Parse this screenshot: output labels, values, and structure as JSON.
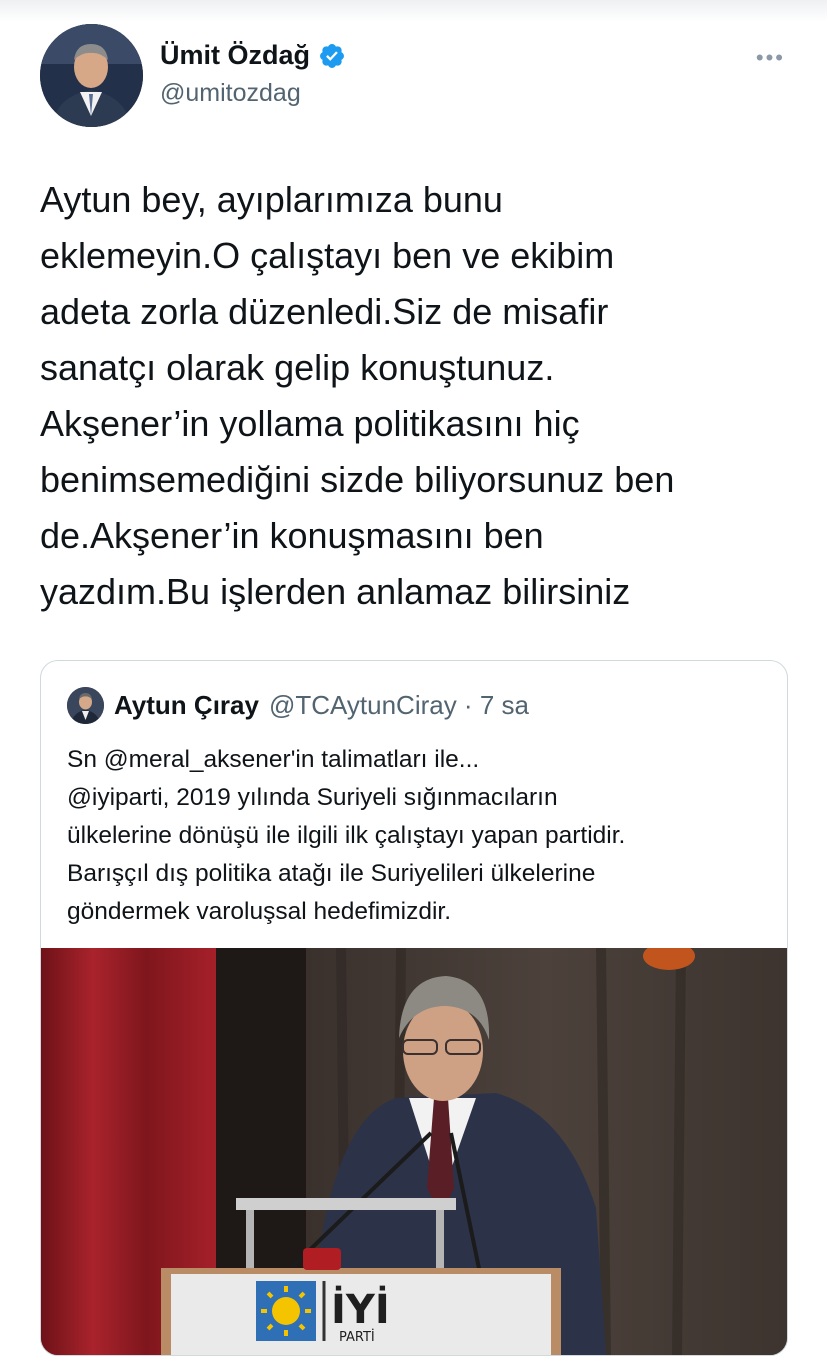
{
  "tweet": {
    "author_name": "Ümit Özdağ",
    "author_handle": "@umitozdag",
    "lines": [
      "Aytun bey, ayıplarımıza bunu",
      "eklemeyin.O çalıştayı ben ve ekibim",
      "adeta zorla düzenledi.Siz de misafir",
      "sanatçı olarak gelip konuştunuz.",
      "Akşener’in yollama politikasını hiç",
      "benimsemediğini sizde biliyorsunuz ben",
      "de.Akşener’in konuşmasını ben",
      "yazdım.Bu işlerden anlamaz bilirsiniz"
    ],
    "more_label": "•••"
  },
  "quote": {
    "author_name": "Aytun Çıray",
    "author_handle": "@TCAytunCiray · 7 sa",
    "lines": [
      "Sn @meral_aksener'in talimatları ile...",
      "@iyiparti, 2019 yılında Suriyeli sığınmacıların",
      "ülkelerine dönüşü ile ilgili ilk çalıştayı yapan partidir.",
      "Barışçıl dış politika atağı ile Suriyelileri ülkelerine",
      "göndermek varoluşsal hedefimizdir."
    ],
    "media": {
      "podium_logo_main": "İYİ",
      "podium_logo_sub": "PARTİ"
    }
  },
  "colors": {
    "verified": "#1d9bf0",
    "text": "#0f1419",
    "secondary": "#536471",
    "border": "#cfd9de",
    "curtain_red": "#8e1b22"
  }
}
